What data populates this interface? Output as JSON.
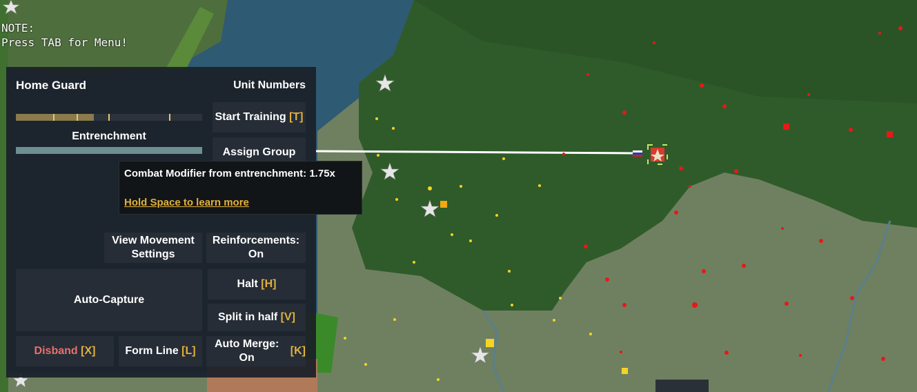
{
  "note": {
    "line1": "NOTE:",
    "line2": "Press TAB for Menu!"
  },
  "panel": {
    "title": "Home Guard",
    "unit_numbers_label": "Unit Numbers",
    "start_training": {
      "label": "Start Training",
      "key": "[T]"
    },
    "assign_group": {
      "label": "Assign Group"
    },
    "entrenchment_label": "Entrenchment",
    "strength_fraction": 0.42,
    "entrenchment_fraction": 1.0,
    "view_movement_settings": {
      "line1": "View Movement",
      "line2": "Settings"
    },
    "reinforcements": {
      "label": "Reinforcements: On"
    },
    "auto_capture": {
      "label": "Auto-Capture"
    },
    "halt": {
      "label": "Halt",
      "key": "[H]"
    },
    "split_half": {
      "label": "Split in half",
      "key": "[V]"
    },
    "disband": {
      "label": "Disband",
      "key": "[X]"
    },
    "form_line": {
      "label": "Form Line",
      "key": "[L]"
    },
    "auto_merge": {
      "label": "Auto Merge: On",
      "key": "[K]"
    }
  },
  "tooltip": {
    "line1": "Combat Modifier from entrenchment: 1.75x",
    "line2": "Hold Space to learn more"
  },
  "colors": {
    "panel_bg": "#1c2128",
    "button_bg": "#262d37",
    "hotkey": "#e2b13c",
    "disband": "#e8706a",
    "entrenchment_bar": "#6d8f92",
    "strength_bar": "#8a7a4c",
    "enemy_dots": "#e81818",
    "ally_dots": "#f5d327"
  },
  "icons": [
    "star-city-icon",
    "flag-russia-icon",
    "unit-marker-icon",
    "speaker-icon"
  ]
}
